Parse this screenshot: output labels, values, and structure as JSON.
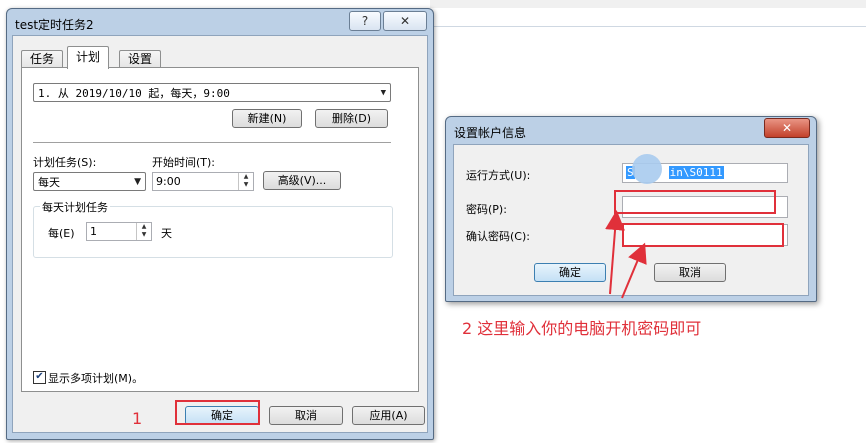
{
  "main_dialog": {
    "title": "test定时任务2",
    "help_button": "?",
    "close_button": "✕",
    "tabs": [
      {
        "label": "任务",
        "active": false
      },
      {
        "label": "计划",
        "active": true
      },
      {
        "label": "设置",
        "active": false
      }
    ],
    "schedule_select_value": "1. 从 2019/10/10 起，每天，9:00",
    "new_button": "新建(N)",
    "delete_button": "删除(D)",
    "schedule_task_label": "计划任务(S):",
    "schedule_task_value": "每天",
    "start_time_label": "开始时间(T):",
    "start_time_value": "9:00",
    "advanced_button": "高级(V)...",
    "daily_group_title": "每天计划任务",
    "every_label": "每(E)",
    "every_value": "1",
    "days_unit": "天",
    "show_multiple_label": "显示多项计划(M)。",
    "show_multiple_checked": true,
    "ok_button": "确定",
    "cancel_button": "取消",
    "apply_button": "应用(A)"
  },
  "account_dialog": {
    "title": "设置帐户信息",
    "close_button": "✕",
    "run_as_label": "运行方式(U):",
    "run_as_value_prefix": "S",
    "run_as_value_selected": "in\\S0111",
    "password_label": "密码(P):",
    "password_value": "",
    "confirm_password_label": "确认密码(C):",
    "confirm_password_value": "",
    "ok_button": "确定",
    "cancel_button": "取消"
  },
  "annotations": {
    "step1": "1",
    "step2": "2 这里输入你的电脑开机密码即可"
  },
  "colors": {
    "annotation_red": "#e0303a",
    "window_frame": "#bcd0e6",
    "selection": "#3399ff"
  }
}
